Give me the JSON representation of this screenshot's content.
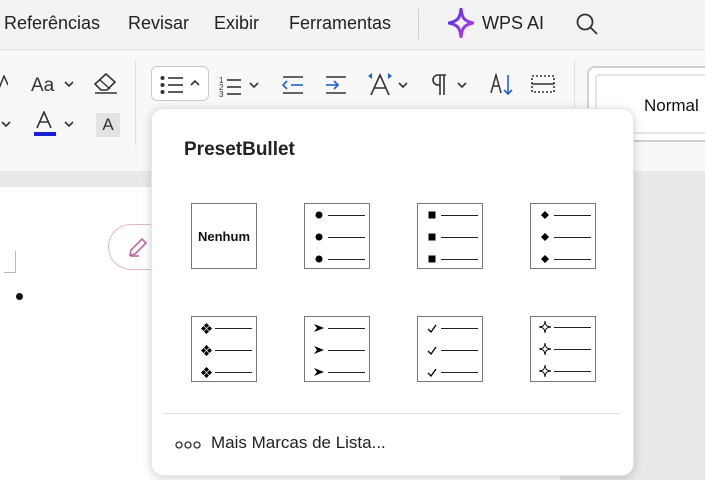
{
  "menubar": {
    "items": [
      {
        "label": "Referências"
      },
      {
        "label": "Revisar"
      },
      {
        "label": "Exibir"
      },
      {
        "label": "Ferramentas"
      }
    ],
    "wps_ai_label": "WPS AI",
    "icons": {
      "wps_ai": "sparkle-star-icon",
      "search": "search-icon"
    }
  },
  "toolbar": {
    "change_case_label": "Aa",
    "font_color": "#1a1fd6",
    "highlight_label": "A",
    "style_preview": "Normal",
    "icons": [
      "change-case-icon",
      "clear-format-icon",
      "font-color-icon",
      "character-shading-icon",
      "bullets-icon",
      "numbering-icon",
      "decrease-indent-icon",
      "increase-indent-icon",
      "line-spacing-icon",
      "paragraph-mark-icon",
      "sort-icon",
      "table-border-icon"
    ]
  },
  "dropdown": {
    "title": "PresetBullet",
    "none_label": "Nenhum",
    "options": [
      {
        "marker": "none"
      },
      {
        "marker": "round-dot"
      },
      {
        "marker": "square"
      },
      {
        "marker": "diamond"
      },
      {
        "marker": "four-diamond"
      },
      {
        "marker": "arrowhead"
      },
      {
        "marker": "checkmark"
      },
      {
        "marker": "four-point-star"
      }
    ],
    "more_label": "Mais Marcas de Lista..."
  },
  "colors": {
    "accent_pink": "#e7b6cd",
    "wps_ai_gradient": [
      "#4b2cf5",
      "#c43fe0"
    ]
  }
}
